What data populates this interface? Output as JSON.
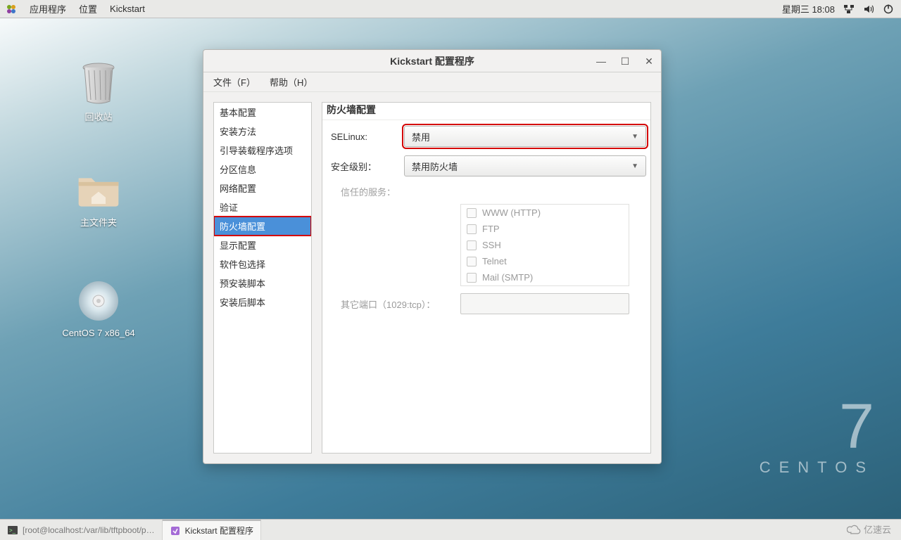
{
  "panel": {
    "apps": "应用程序",
    "places": "位置",
    "active_app": "Kickstart",
    "clock": "星期三 18:08"
  },
  "desktop": {
    "trash": "回收站",
    "home": "主文件夹",
    "disc": "CentOS 7 x86_64"
  },
  "centos": {
    "number": "7",
    "word": "CENTOS"
  },
  "window": {
    "title": "Kickstart 配置程序",
    "menu": {
      "file": "文件（F）",
      "help": "帮助（H）"
    }
  },
  "sidebar": {
    "items": [
      "基本配置",
      "安装方法",
      "引导装载程序选项",
      "分区信息",
      "网络配置",
      "验证",
      "防火墙配置",
      "显示配置",
      "软件包选择",
      "预安装脚本",
      "安装后脚本"
    ],
    "selected_index": 6
  },
  "form": {
    "section_title": "防火墙配置",
    "selinux_label": "SELinux:",
    "selinux_value": "禁用",
    "level_label": "安全级别：",
    "level_value": "禁用防火墙",
    "trusted_label": "信任的服务：",
    "services": [
      "WWW (HTTP)",
      "FTP",
      "SSH",
      "Telnet",
      "Mail (SMTP)"
    ],
    "ports_label": "其它端口（1029:tcp）："
  },
  "taskbar": {
    "terminal": "[root@localhost:/var/lib/tftpboot/p…",
    "kickstart": "Kickstart 配置程序"
  },
  "brand": "亿速云"
}
